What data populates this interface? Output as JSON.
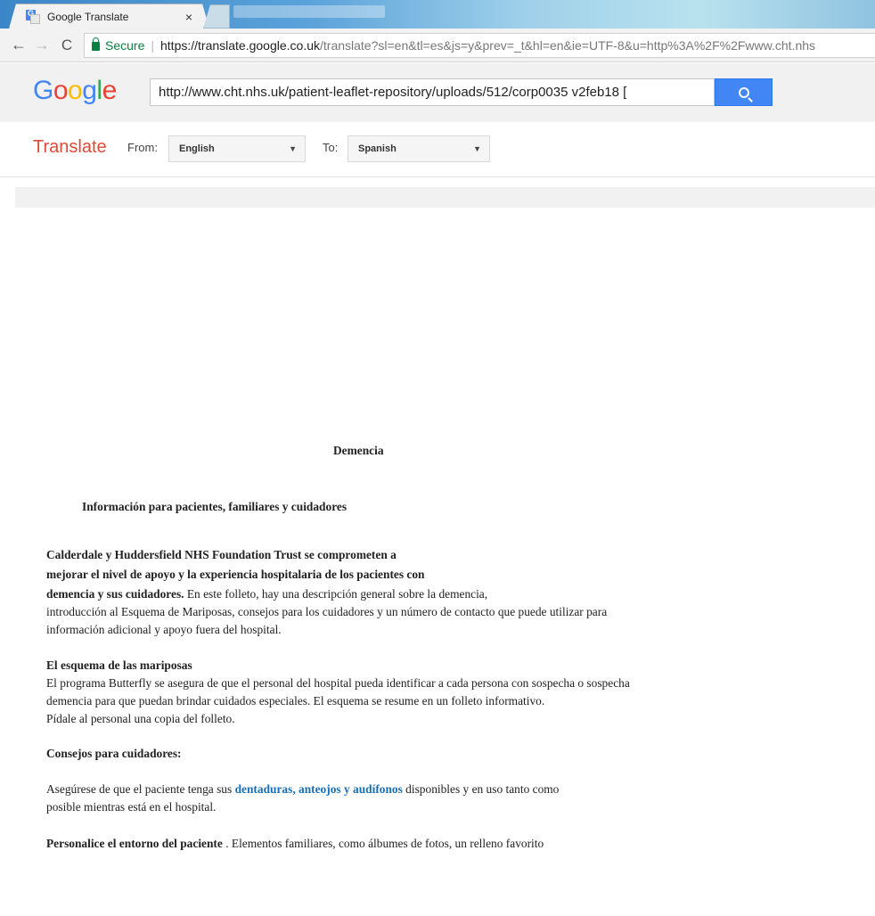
{
  "browser": {
    "tab_title": "Google Translate",
    "tab_close": "×",
    "nav_back": "←",
    "nav_forward": "→",
    "nav_reload": "C",
    "secure_label": "Secure",
    "url_host": "https://translate.google.co.uk",
    "url_path": "/translate?sl=en&tl=es&js=y&prev=_t&hl=en&ie=UTF-8&u=http%3A%2F%2Fwww.cht.nhs"
  },
  "google": {
    "logo_letters": [
      "G",
      "o",
      "o",
      "g",
      "l",
      "e"
    ],
    "search_value": "http://www.cht.nhs.uk/patient-leaflet-repository/uploads/512/corp0035 v2feb18   [",
    "search_icon": "magnifier-icon"
  },
  "translate_bar": {
    "title": "Translate",
    "from_label": "From:",
    "from_value": "English",
    "to_label": "To:",
    "to_value": "Spanish",
    "caret": "▼"
  },
  "document": {
    "title": "Demencia",
    "subtitle": "Información para pacientes, familiares y cuidadores",
    "intro": {
      "bold_line1": "Calderdale y Huddersfield NHS Foundation Trust se comprometen a",
      "bold_line2": "mejorar el nivel de apoyo y la experiencia hospitalaria de los pacientes con",
      "bold_line3": "demencia y sus cuidadores.",
      "line3_rest": " En este folleto, hay una descripción general sobre la demencia,",
      "line4": "introducción al Esquema de Mariposas, consejos para los cuidadores y un número de contacto que puede utilizar para",
      "line5": "información adicional y apoyo fuera del hospital."
    },
    "butterfly": {
      "heading": "El esquema de las mariposas",
      "line1": "El programa Butterfly se asegura de que el personal del hospital pueda identificar a cada persona con sospecha o sospecha",
      "line2": "demencia para que puedan brindar cuidados especiales. El esquema se resume en un folleto informativo.",
      "line3": "Pídale al personal una copia del folleto."
    },
    "carers": {
      "heading": "Consejos para cuidadores:",
      "tip1_pre": "Asegúrese de que el paciente tenga sus ",
      "tip1_link": "dentaduras, anteojos y audífonos",
      "tip1_post": " disponibles y en uso tanto como",
      "tip1_line2": "posible mientras está en el hospital.",
      "tip2_bold": "Personalice el entorno del paciente",
      "tip2_rest": " . Elementos familiares, como álbumes de fotos, un relleno favorito"
    }
  }
}
